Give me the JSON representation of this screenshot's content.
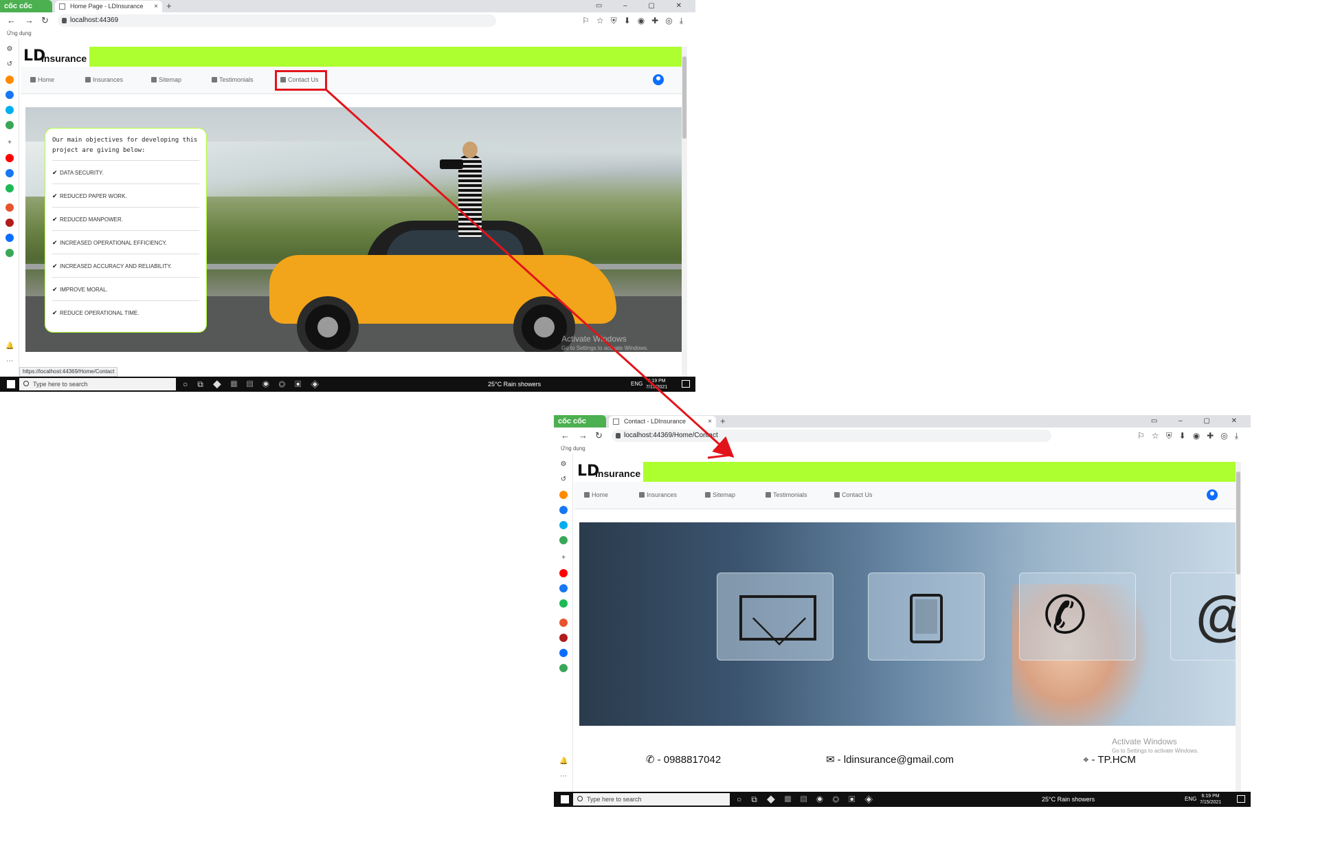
{
  "colors": {
    "accent_green": "#adff2f",
    "annotation_red": "#e2141b",
    "brand_blue": "#0d6efd"
  },
  "screenshot_home": {
    "browser": {
      "brand": "cốc cốc",
      "tab_title": "Home Page - LDInsurance",
      "url": "localhost:44369",
      "bookmarks_label": "Ứng dụng"
    },
    "logo": {
      "mark": "LD",
      "text": "Insurance"
    },
    "nav": [
      {
        "label": "Home",
        "icon": "home-icon"
      },
      {
        "label": "Insurances",
        "icon": "document-icon"
      },
      {
        "label": "Sitemap",
        "icon": "sitemap-icon"
      },
      {
        "label": "Testimonials",
        "icon": "comment-icon"
      },
      {
        "label": "Contact Us",
        "icon": "book-icon"
      }
    ],
    "objectives": {
      "title": "Our main objectives for developing this project are giving below:",
      "items": [
        "DATA SECURITY.",
        "REDUCED PAPER WORK.",
        "REDUCED MANPOWER.",
        "INCREASED OPERATIONAL EFFICIENCY.",
        "INCREASED ACCURACY AND RELIABILITY.",
        "IMPROVE MORAL.",
        "REDUCE OPERATIONAL TIME."
      ]
    },
    "watermark": {
      "title": "Activate Windows",
      "subtitle": "Go to Settings to activate Windows."
    },
    "status_link": "https://localhost:44369/Home/Contact",
    "taskbar": {
      "search_placeholder": "Type here to search",
      "weather": "25°C  Rain showers",
      "lang": "ENG",
      "time": "6:19 PM",
      "date": "7/15/2021"
    }
  },
  "screenshot_contact": {
    "browser": {
      "brand": "cốc cốc",
      "tab_title": "Contact - LDInsurance",
      "url": "localhost:44369/Home/Contact",
      "bookmarks_label": "Ứng dụng"
    },
    "logo": {
      "mark": "LD",
      "text": "Insurance"
    },
    "nav": [
      {
        "label": "Home",
        "icon": "home-icon"
      },
      {
        "label": "Insurances",
        "icon": "document-icon"
      },
      {
        "label": "Sitemap",
        "icon": "sitemap-icon"
      },
      {
        "label": "Testimonials",
        "icon": "comment-icon"
      },
      {
        "label": "Contact Us",
        "icon": "book-icon"
      }
    ],
    "contact": {
      "phone": "- 0988817042",
      "email": "- ldinsurance@gmail.com",
      "location": "- TP.HCM"
    },
    "watermark": {
      "title": "Activate Windows",
      "subtitle": "Go to Settings to activate Windows."
    },
    "taskbar": {
      "search_placeholder": "Type here to search",
      "weather": "25°C  Rain showers",
      "lang": "ENG",
      "time": "6:19 PM",
      "date": "7/15/2021"
    }
  }
}
